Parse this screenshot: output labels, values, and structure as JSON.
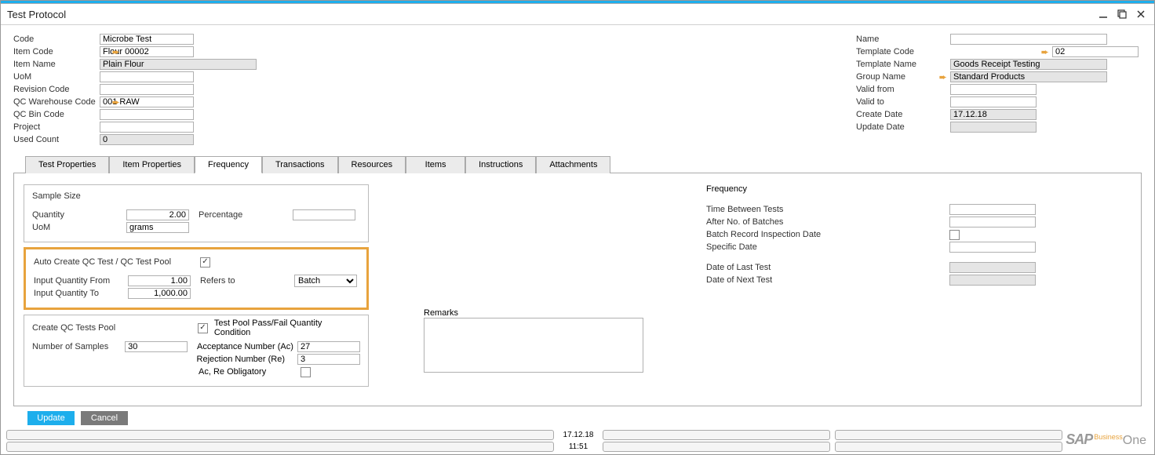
{
  "window": {
    "title": "Test Protocol"
  },
  "left": {
    "code_label": "Code",
    "code": "Microbe Test",
    "item_code_label": "Item Code",
    "item_code": "Flour 00002",
    "item_name_label": "Item Name",
    "item_name": "Plain Flour",
    "uom_label": "UoM",
    "uom": "",
    "rev_label": "Revision Code",
    "rev": "",
    "qc_wh_label": "QC Warehouse Code",
    "qc_wh": "001 RAW",
    "qc_bin_label": "QC Bin Code",
    "qc_bin": "",
    "project_label": "Project",
    "project": "",
    "used_label": "Used Count",
    "used": "0"
  },
  "right": {
    "name_label": "Name",
    "name": "",
    "tpl_code_label": "Template Code",
    "tpl_code": "02",
    "tpl_name_label": "Template Name",
    "tpl_name": "Goods Receipt Testing",
    "group_label": "Group Name",
    "group": "Standard Products",
    "vfrom_label": "Valid from",
    "vfrom": "",
    "vto_label": "Valid to",
    "vto": "",
    "cdate_label": "Create Date",
    "cdate": "17.12.18",
    "udate_label": "Update Date",
    "udate": ""
  },
  "tabs": [
    "Test Properties",
    "Item Properties",
    "Frequency",
    "Transactions",
    "Resources",
    "Items",
    "Instructions",
    "Attachments"
  ],
  "active_tab": 2,
  "sample": {
    "title": "Sample Size",
    "qty_label": "Quantity",
    "qty": "2.00",
    "uom_label": "UoM",
    "uom": "grams",
    "pct_label": "Percentage",
    "pct": ""
  },
  "auto": {
    "title": "Auto Create QC Test / QC Test Pool",
    "from_label": "Input Quantity From",
    "from": "1.00",
    "to_label": "Input Quantity To",
    "to": "1,000.00",
    "refers_label": "Refers to",
    "refers": "Batch"
  },
  "pool": {
    "create_label": "Create QC Tests Pool",
    "cond_label": "Test Pool Pass/Fail Quantity Condition",
    "num_label": "Number of Samples",
    "num": "30",
    "ac_label": "Acceptance Number (Ac)",
    "ac": "27",
    "re_label": "Rejection Number (Re)",
    "re": "3",
    "oblig_label": "Ac, Re Obligatory"
  },
  "remarks_label": "Remarks",
  "freq": {
    "title": "Frequency",
    "tbt_label": "Time Between Tests",
    "tbt": "",
    "anb_label": "After No. of Batches",
    "anb": "",
    "brid_label": "Batch Record Inspection Date",
    "sd_label": "Specific Date",
    "sd": "",
    "last_label": "Date of Last Test",
    "last": "",
    "next_label": "Date of Next Test",
    "next": ""
  },
  "buttons": {
    "update": "Update",
    "cancel": "Cancel"
  },
  "status": {
    "date": "17.12.18",
    "time": "11:51"
  }
}
